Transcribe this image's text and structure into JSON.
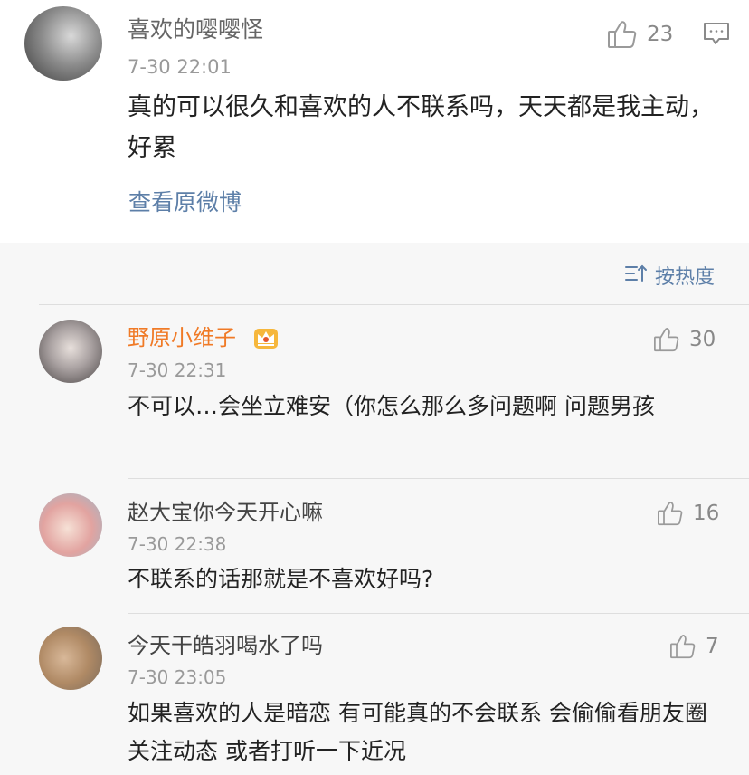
{
  "post": {
    "username": "喜欢的嘤嘤怪",
    "timestamp": "7-30 22:01",
    "like_count": "23",
    "text": "真的可以很久和喜欢的人不联系吗，天天都是我主动，好累",
    "view_original_label": "查看原微博"
  },
  "sort": {
    "label": "按热度"
  },
  "comments": [
    {
      "username": "野原小维子",
      "timestamp": "7-30 22:31",
      "like_count": "30",
      "text": "不可以…会坐立难安（你怎么那么多问题啊 问题男孩"
    },
    {
      "username": "赵大宝你今天开心嘛",
      "timestamp": "7-30 22:38",
      "like_count": "16",
      "text": "不联系的话那就是不喜欢好吗?"
    },
    {
      "username": "今天干皓羽喝水了吗",
      "timestamp": "7-30 23:05",
      "like_count": "7",
      "text": "如果喜欢的人是暗恋 有可能真的不会联系 会偷偷看朋友圈关注动态 或者打听一下近况"
    }
  ],
  "colors": {
    "link": "#5d7fa8",
    "vip_username": "#f07a26",
    "timestamp": "#9a9a9a"
  },
  "icons": [
    "thumbs-up-icon",
    "comment-icon",
    "sort-icon",
    "vip-crown-badge-icon"
  ]
}
